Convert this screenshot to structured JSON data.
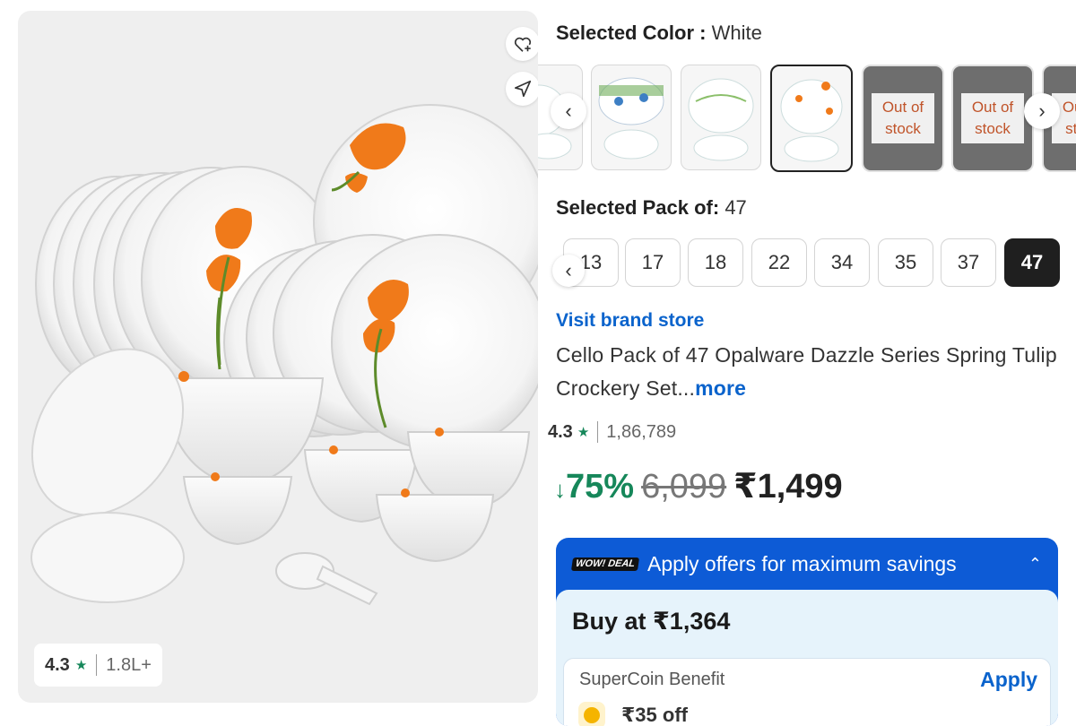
{
  "image_panel": {
    "rating": "4.3",
    "review_count": "1.8L+"
  },
  "color_selector": {
    "label": "Selected Color :",
    "value": "White",
    "out_of_stock_text": "Out of stock"
  },
  "pack_selector": {
    "label": "Selected Pack of:",
    "value": "47",
    "options": [
      "13",
      "17",
      "18",
      "22",
      "34",
      "35",
      "37",
      "47"
    ]
  },
  "product": {
    "brand_link": "Visit brand store",
    "title": "Cello Pack of 47 Opalware Dazzle Series Spring Tulip Crockery Set...",
    "more_label": "more",
    "rating": "4.3",
    "rating_count": "1,86,789",
    "discount": "75%",
    "mrp": "6,099",
    "price": "₹1,499"
  },
  "offers": {
    "badge": "WOW! DEAL",
    "header": "Apply offers for maximum savings",
    "buy_at": "Buy at ₹1,364",
    "supercoin": {
      "title": "SuperCoin Benefit",
      "apply_label": "Apply",
      "amount": "₹35 off"
    }
  },
  "colors": {
    "accent_blue": "#0a63cc",
    "discount_green": "#16875a",
    "offer_blue": "#0d5bd6",
    "tulip_orange": "#f07a1a"
  }
}
